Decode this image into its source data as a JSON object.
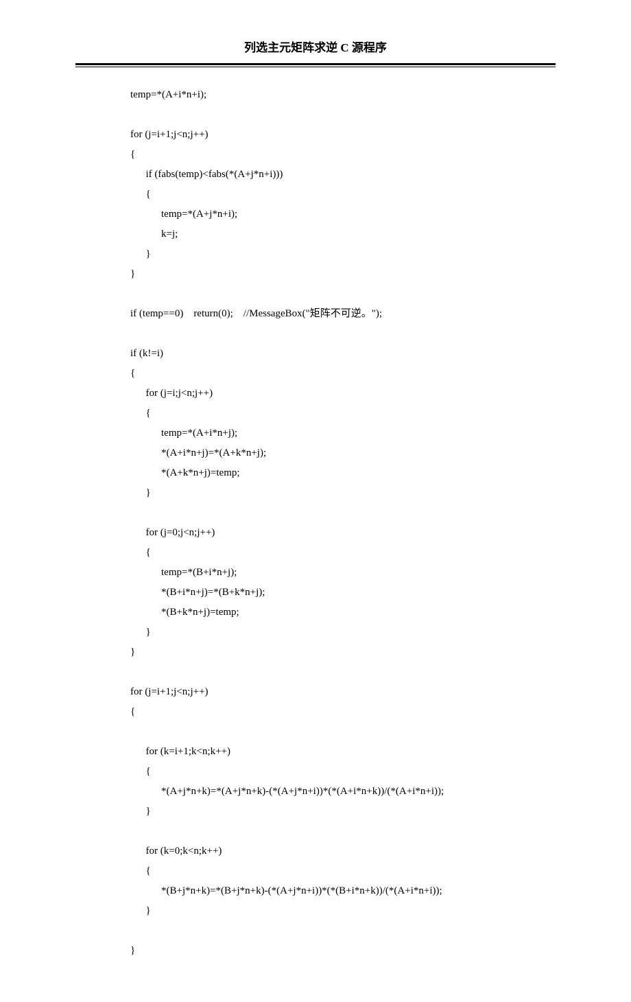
{
  "header": {
    "title": "列选主元矩阵求逆 C 源程序"
  },
  "code": {
    "lines": [
      "temp=*(A+i*n+i);",
      "",
      "for (j=i+1;j<n;j++)",
      "{",
      "      if (fabs(temp)<fabs(*(A+j*n+i)))",
      "      {",
      "            temp=*(A+j*n+i);",
      "            k=j;",
      "      }",
      "}",
      "",
      "if (temp==0)    return(0);    //MessageBox(\"矩阵不可逆。\");",
      "",
      "if (k!=i)",
      "{",
      "      for (j=i;j<n;j++)",
      "      {",
      "            temp=*(A+i*n+j);",
      "            *(A+i*n+j)=*(A+k*n+j);",
      "            *(A+k*n+j)=temp;",
      "      }",
      "",
      "      for (j=0;j<n;j++)",
      "      {",
      "            temp=*(B+i*n+j);",
      "            *(B+i*n+j)=*(B+k*n+j);",
      "            *(B+k*n+j)=temp;",
      "      }",
      "}",
      "",
      "for (j=i+1;j<n;j++)",
      "{",
      "",
      "      for (k=i+1;k<n;k++)",
      "      {",
      "            *(A+j*n+k)=*(A+j*n+k)-(*(A+j*n+i))*(*(A+i*n+k))/(*(A+i*n+i));",
      "      }",
      "",
      "      for (k=0;k<n;k++)",
      "      {",
      "            *(B+j*n+k)=*(B+j*n+k)-(*(A+j*n+i))*(*(B+i*n+k))/(*(A+i*n+i));",
      "      }",
      "",
      "}"
    ]
  }
}
